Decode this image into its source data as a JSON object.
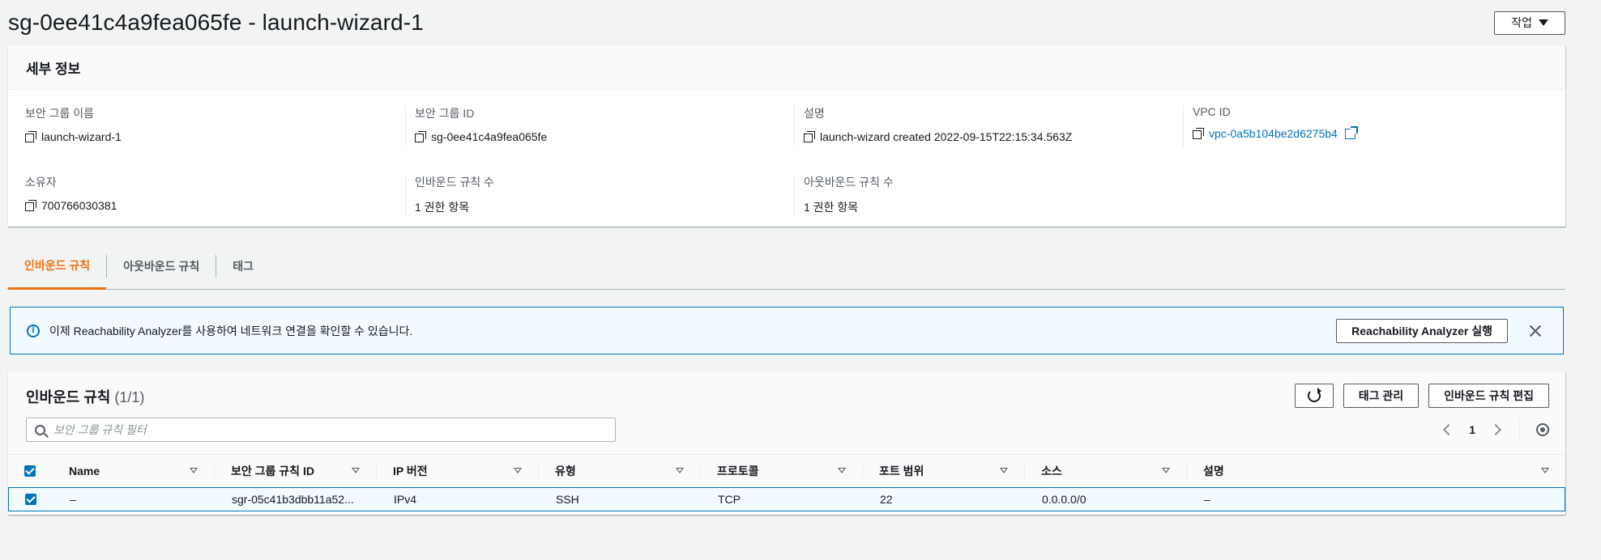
{
  "header": {
    "title": "sg-0ee41c4a9fea065fe - launch-wizard-1",
    "actions_label": "작업"
  },
  "details": {
    "heading": "세부 정보",
    "fields": [
      {
        "label": "보안 그룹 이름",
        "value": "launch-wizard-1"
      },
      {
        "label": "보안 그룹 ID",
        "value": "sg-0ee41c4a9fea065fe"
      },
      {
        "label": "설명",
        "value": "launch-wizard created 2022-09-15T22:15:34.563Z"
      },
      {
        "label": "VPC ID",
        "value": "vpc-0a5b104be2d6275b4"
      },
      {
        "label": "소유자",
        "value": "700766030381"
      },
      {
        "label": "인바운드 규칙 수",
        "value": "1 권한 항목"
      },
      {
        "label": "아웃바운드 규칙 수",
        "value": "1 권한 항목"
      }
    ]
  },
  "tabs": [
    {
      "label": "인바운드 규칙",
      "active": true
    },
    {
      "label": "아웃바운드 규칙",
      "active": false
    },
    {
      "label": "태그",
      "active": false
    }
  ],
  "alert": {
    "text": "이제 Reachability Analyzer를 사용하여 네트워크 연결을 확인할 수 있습니다.",
    "button_label": "Reachability Analyzer 실행"
  },
  "rules": {
    "title": "인바운드 규칙",
    "count": "(1/1)",
    "manage_tags_label": "태그 관리",
    "edit_label": "인바운드 규칙 편집",
    "search_placeholder": "보안 그룹 규칙 필터",
    "page": "1",
    "columns": [
      "Name",
      "보안 그룹 규칙 ID",
      "IP 버전",
      "유형",
      "프로토콜",
      "포트 범위",
      "소스",
      "설명"
    ],
    "rows": [
      [
        "–",
        "sgr-05c41b3dbb11a52...",
        "IPv4",
        "SSH",
        "TCP",
        "22",
        "0.0.0.0/0",
        "–"
      ]
    ]
  },
  "colors": {
    "accent_orange": "#ec7211",
    "link_blue": "#0073bb",
    "info_bg": "#f1faff"
  }
}
